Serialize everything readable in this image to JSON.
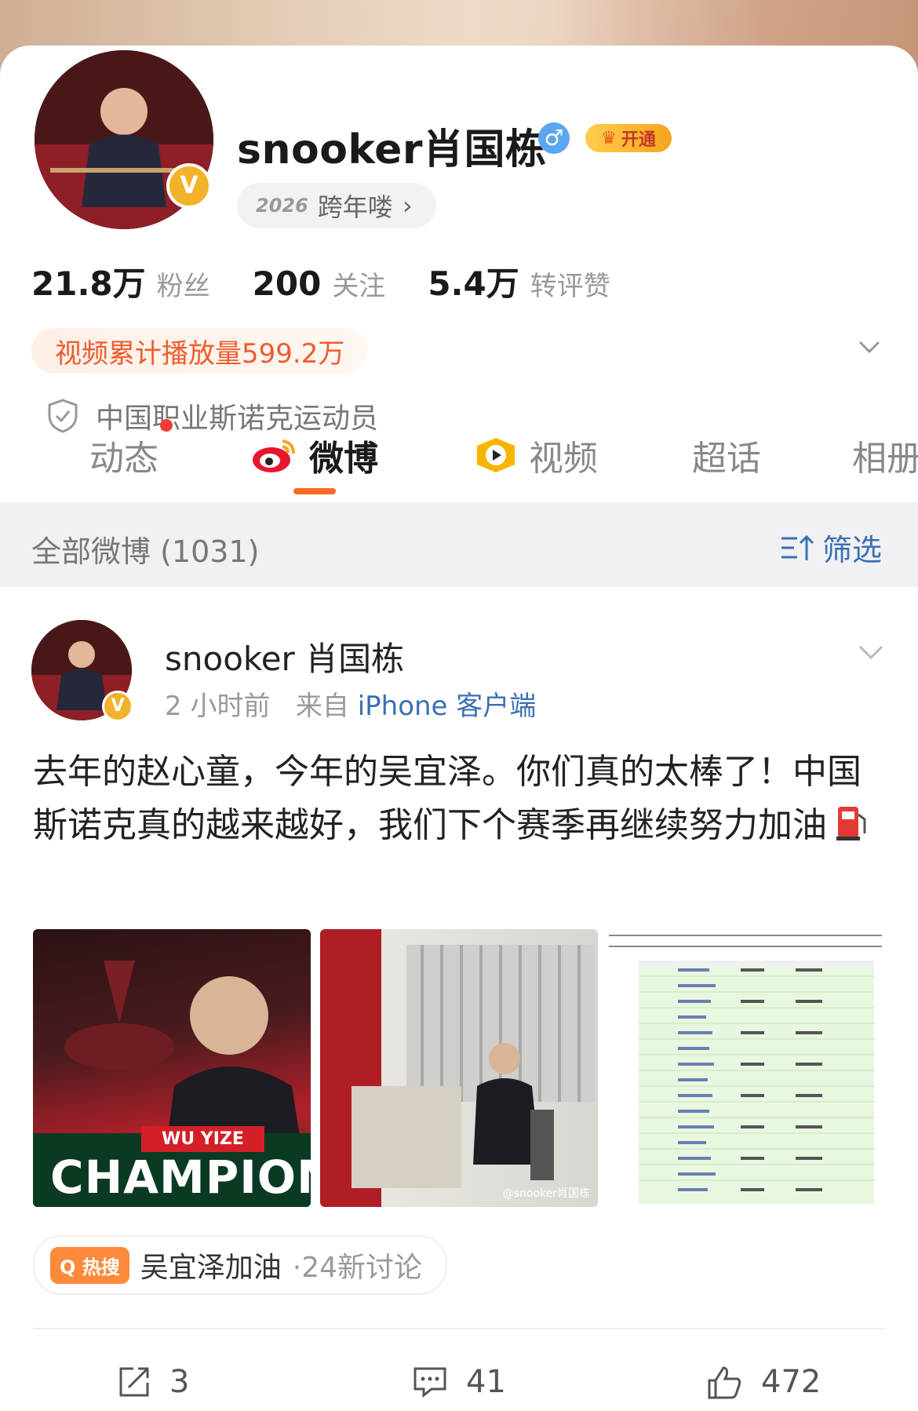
{
  "profile": {
    "name": "snooker肖国栋",
    "gender_symbol": "♂",
    "vip_label": "开通",
    "vbadge": "V",
    "newyear_year": "2026",
    "newyear_label": "跨年喽",
    "stats": [
      {
        "num": "21.8万",
        "label": "粉丝"
      },
      {
        "num": "200",
        "label": "关注"
      },
      {
        "num": "5.4万",
        "label": "转评赞"
      }
    ],
    "play_count": "视频累计播放量599.2万",
    "verification": "中国职业斯诺克运动员"
  },
  "tabs": [
    {
      "label": "动态",
      "has_dot": true
    },
    {
      "label": "微博",
      "active": true
    },
    {
      "label": "视频"
    },
    {
      "label": "超话"
    },
    {
      "label": "相册"
    }
  ],
  "filter": {
    "all_label": "全部微博 (1031)",
    "filter_label": "筛选"
  },
  "post": {
    "author": "snooker 肖国栋",
    "time": "2 小时前",
    "source_prefix": "来自",
    "source": "iPhone 客户端",
    "text": "去年的赵心童，今年的吴宜泽。你们真的太棒了！中国斯诺克真的越来越好，我们下个赛季再继续努力加油",
    "images": [
      {
        "desc": "champion-poster",
        "banner": "WU YIZE",
        "headline": "CHAMPION"
      },
      {
        "desc": "locker-room-photo",
        "watermark": "@snooker肖国栋"
      },
      {
        "desc": "ranking-table-screenshot"
      }
    ],
    "hot_tag": "热搜",
    "hot_topic": "吴宜泽加油",
    "hot_sub": "·24新讨论",
    "actions": {
      "repost": "3",
      "comments": "41",
      "likes": "472"
    }
  },
  "colors": {
    "accent_orange": "#f96a25",
    "link_blue": "#3b6fb6",
    "play_badge_text": "#ef5b2d"
  }
}
